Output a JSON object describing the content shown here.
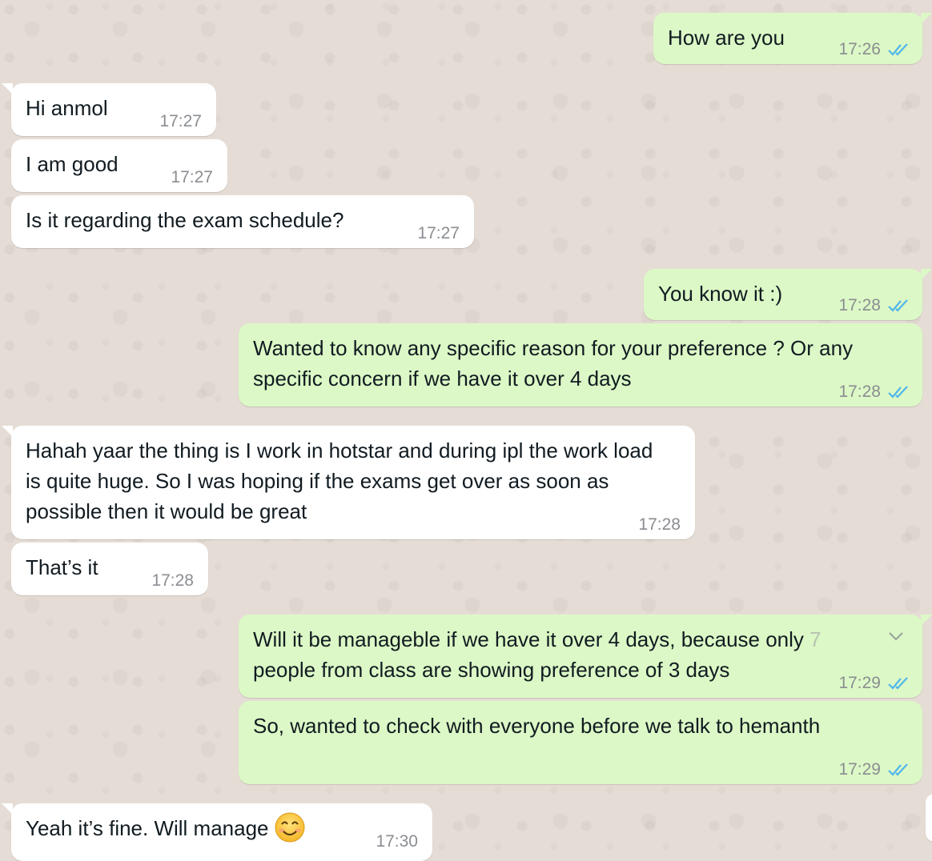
{
  "colors": {
    "background": "#e5ddd5",
    "incoming_bubble": "#ffffff",
    "outgoing_bubble": "#dcf8c6",
    "timestamp": "#8a8d91",
    "read_ticks": "#4fb6ec"
  },
  "messages": [
    {
      "direction": "outgoing",
      "text": "How are you",
      "time": "17:26",
      "status_icon": "double-check-read-icon"
    },
    {
      "direction": "incoming",
      "text": "Hi anmol",
      "time": "17:27"
    },
    {
      "direction": "incoming",
      "text": "I am good",
      "time": "17:27"
    },
    {
      "direction": "incoming",
      "text": "Is it regarding the exam schedule?",
      "time": "17:27"
    },
    {
      "direction": "outgoing",
      "text": "You know it :)",
      "time": "17:28",
      "status_icon": "double-check-read-icon"
    },
    {
      "direction": "outgoing",
      "text": "Wanted to know any specific reason for your preference ? Or any specific concern if we have it over 4 days",
      "time": "17:28",
      "status_icon": "double-check-read-icon"
    },
    {
      "direction": "incoming",
      "text": "Hahah yaar the thing is I work in hotstar and during ipl the work load is quite huge. So I was hoping if the exams get over as soon as possible then it would be great",
      "time": "17:28"
    },
    {
      "direction": "incoming",
      "text": "That’s it",
      "time": "17:28"
    },
    {
      "direction": "outgoing",
      "text_main": "Will it be manageble if we have it over 4 days, because only ",
      "text_fade": "7",
      "text_end": "\npeople from class are showing preference of 3 days",
      "time": "17:29",
      "status_icon": "double-check-read-icon",
      "menu_icon": "chevron-down-icon"
    },
    {
      "direction": "outgoing",
      "text": "So, wanted to check with everyone before we talk to hemanth",
      "time": "17:29",
      "status_icon": "double-check-read-icon"
    },
    {
      "direction": "incoming",
      "text": "Yeah it’s fine. Will manage",
      "emoji": "smiling-face-emoji-icon",
      "time": "17:30"
    }
  ]
}
